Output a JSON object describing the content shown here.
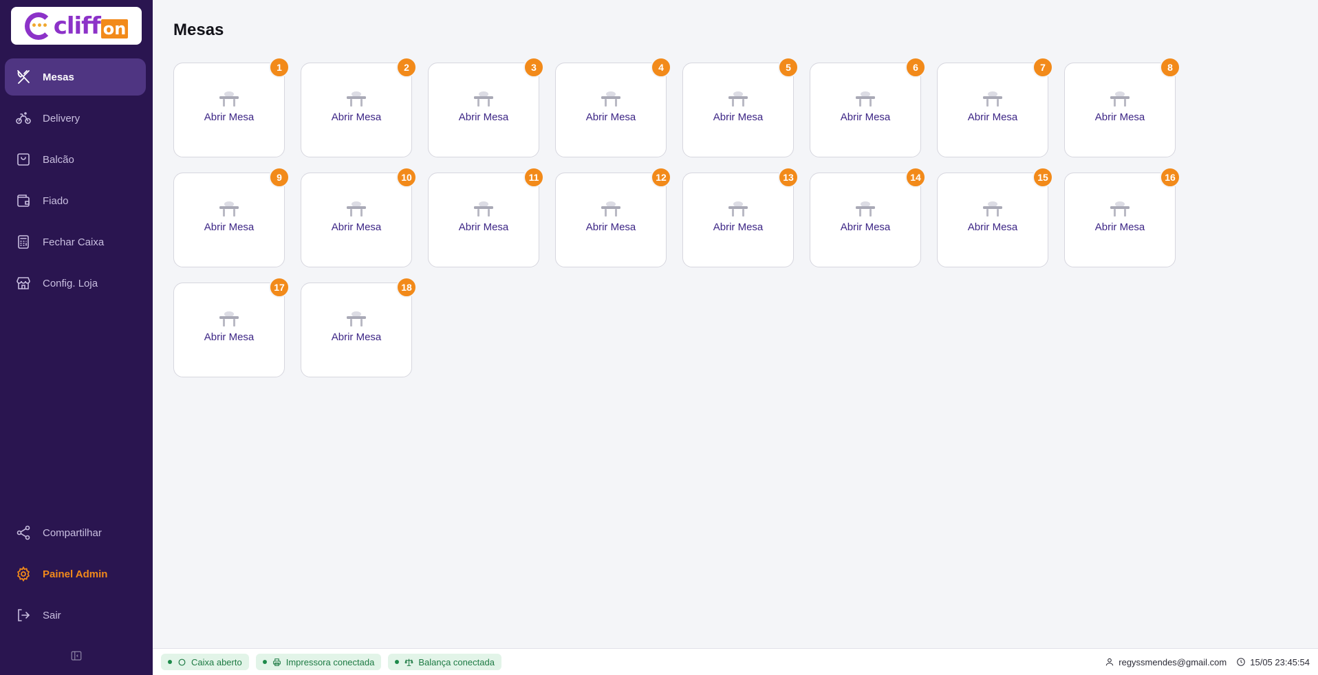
{
  "app": {
    "logo_text_main": "cliff",
    "logo_text_badge": "on"
  },
  "sidebar": {
    "items": [
      {
        "label": "Mesas",
        "icon": "utensils-icon",
        "active": true
      },
      {
        "label": "Delivery",
        "icon": "bicycle-icon",
        "active": false
      },
      {
        "label": "Balcão",
        "icon": "shopping-bag-icon",
        "active": false
      },
      {
        "label": "Fiado",
        "icon": "wallet-icon",
        "active": false
      },
      {
        "label": "Fechar Caixa",
        "icon": "calculator-icon",
        "active": false
      },
      {
        "label": "Config. Loja",
        "icon": "store-icon",
        "active": false
      }
    ],
    "bottom_items": [
      {
        "label": "Compartilhar",
        "icon": "share-icon"
      },
      {
        "label": "Painel Admin",
        "icon": "gear-icon"
      },
      {
        "label": "Sair",
        "icon": "logout-icon"
      }
    ]
  },
  "main": {
    "title": "Mesas",
    "tables": [
      {
        "number": "1",
        "label": "Abrir Mesa"
      },
      {
        "number": "2",
        "label": "Abrir Mesa"
      },
      {
        "number": "3",
        "label": "Abrir Mesa"
      },
      {
        "number": "4",
        "label": "Abrir Mesa"
      },
      {
        "number": "5",
        "label": "Abrir Mesa"
      },
      {
        "number": "6",
        "label": "Abrir Mesa"
      },
      {
        "number": "7",
        "label": "Abrir Mesa"
      },
      {
        "number": "8",
        "label": "Abrir Mesa"
      },
      {
        "number": "9",
        "label": "Abrir Mesa"
      },
      {
        "number": "10",
        "label": "Abrir Mesa"
      },
      {
        "number": "11",
        "label": "Abrir Mesa"
      },
      {
        "number": "12",
        "label": "Abrir Mesa"
      },
      {
        "number": "13",
        "label": "Abrir Mesa"
      },
      {
        "number": "14",
        "label": "Abrir Mesa"
      },
      {
        "number": "15",
        "label": "Abrir Mesa"
      },
      {
        "number": "16",
        "label": "Abrir Mesa"
      },
      {
        "number": "17",
        "label": "Abrir Mesa"
      },
      {
        "number": "18",
        "label": "Abrir Mesa"
      }
    ]
  },
  "status": {
    "pills": [
      {
        "label": "Caixa aberto",
        "icon": "circle-icon"
      },
      {
        "label": "Impressora conectada",
        "icon": "printer-icon"
      },
      {
        "label": "Balança conectada",
        "icon": "scale-icon"
      }
    ],
    "user_email": "regyssmendes@gmail.com",
    "datetime": "15/05 23:45:54"
  },
  "colors": {
    "sidebar_bg": "#2a1550",
    "sidebar_active": "#4f3582",
    "accent_orange": "#f28a1a",
    "brand_purple": "#8c32c8",
    "label_purple": "#3c2585",
    "status_green": "#1d7a43"
  }
}
